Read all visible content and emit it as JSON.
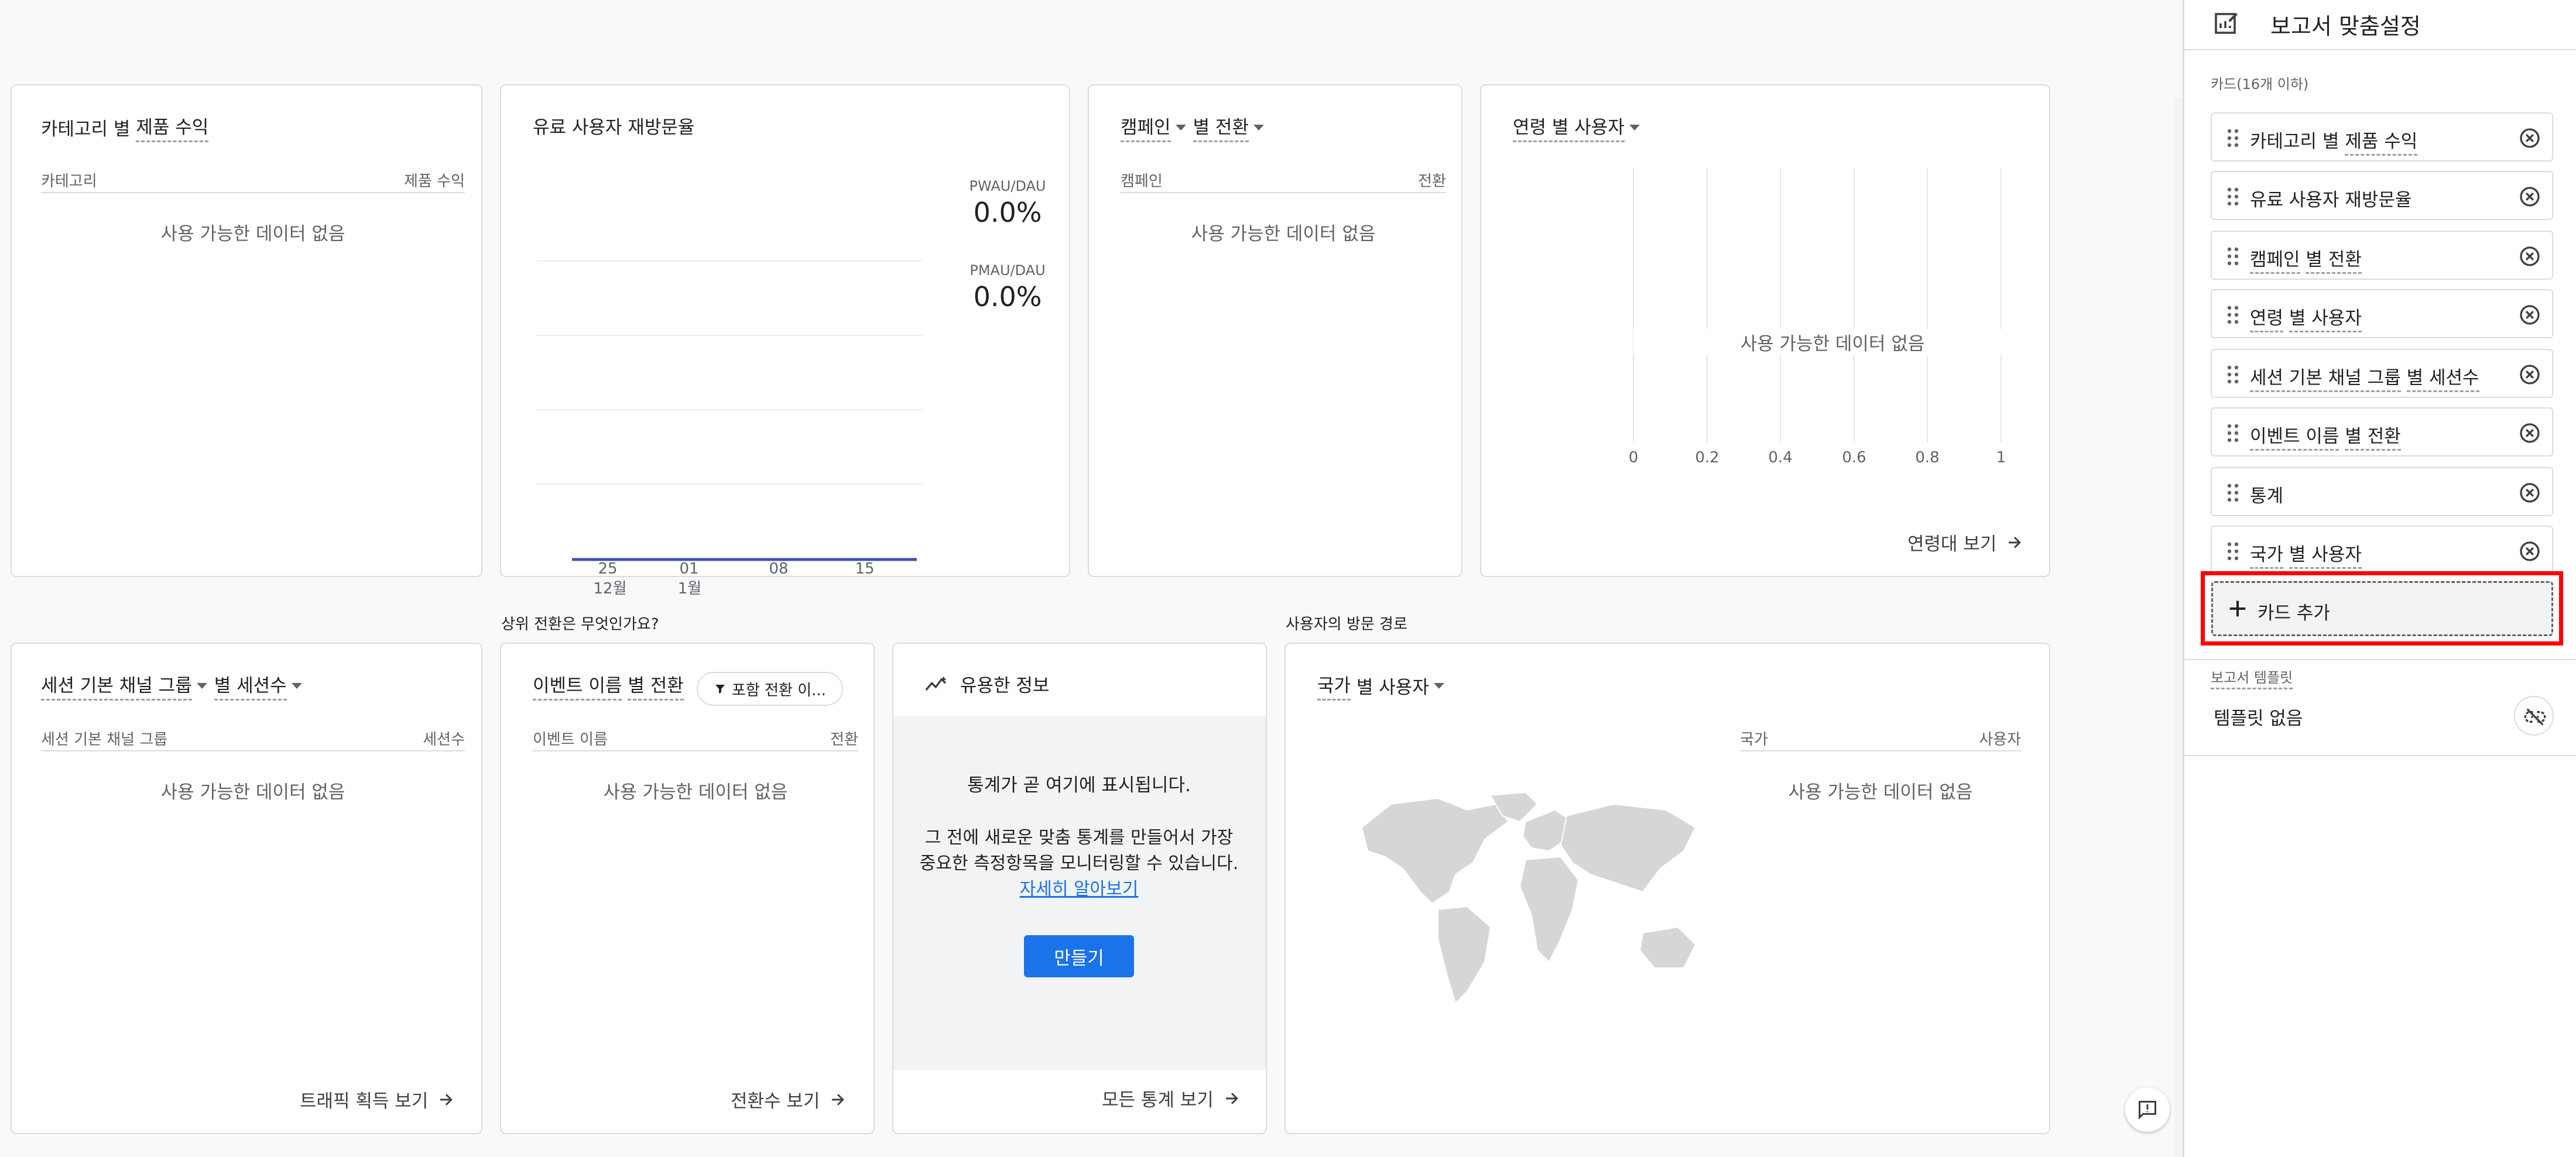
{
  "cards": {
    "category_revenue": {
      "title_prefix": "카테고리 별",
      "title_metric": "제품 수익",
      "col_left": "카테고리",
      "col_right": "제품 수익",
      "nodata": "사용 가능한 데이터 없음"
    },
    "retention": {
      "title": "유료 사용자 재방문율",
      "pwau_label": "PWAU/DAU",
      "pwau_value": "0.0%",
      "pmau_label": "PMAU/DAU",
      "pmau_value": "0.0%",
      "x_ticks": [
        "25",
        "01",
        "08",
        "15"
      ],
      "x_sub": [
        "12월",
        "1월"
      ],
      "line_color": "#3f51b5"
    },
    "campaign": {
      "title_dim": "캠페인",
      "title_metric": "별 전환",
      "col_left": "캠페인",
      "col_right": "전환",
      "nodata": "사용 가능한 데이터 없음"
    },
    "age": {
      "title": "연령 별 사용자",
      "nodata": "사용 가능한 데이터 없음",
      "x_ticks": [
        "0",
        "0.2",
        "0.4",
        "0.6",
        "0.8",
        "1"
      ],
      "footer": "연령대 보기"
    },
    "session_channel": {
      "title_dim": "세션 기본 채널 그룹",
      "title_metric": "별 세션수",
      "col_left": "세션 기본 채널 그룹",
      "col_right": "세션수",
      "nodata": "사용 가능한 데이터 없음",
      "footer": "트래픽 획득 보기"
    },
    "event_conversion": {
      "section_label": "상위 전환은 무엇인가요?",
      "title_dim": "이벤트 이름",
      "title_metric": "별 전환",
      "filter_chip": "포함 전환 이...",
      "col_left": "이벤트 이름",
      "col_right": "전환",
      "nodata": "사용 가능한 데이터 없음",
      "footer": "전환수 보기"
    },
    "insights": {
      "title": "유용한 정보",
      "line1": "통계가 곧 여기에 표시됩니다.",
      "body": "그 전에 새로운 맞춤 통계를 만들어서 가장 중요한 측정항목을 모니터링할 수 있습니다.",
      "learn_more": "자세히 알아보기",
      "create_button": "만들기",
      "footer": "모든 통계 보기"
    },
    "country": {
      "section_label": "사용자의 방문 경로",
      "title_dim": "국가",
      "title_metric": "별 사용자",
      "col_left": "국가",
      "col_right": "사용자",
      "nodata": "사용 가능한 데이터 없음"
    }
  },
  "sidebar": {
    "title": "보고서 맞춤설정",
    "cards_label": "카드(16개 이하)",
    "items": [
      {
        "pre": "카테고리 별",
        "metric": "제품 수익"
      },
      {
        "pre": "",
        "metric": "",
        "plain": "유료 사용자 재방문율"
      },
      {
        "pre": "캠페인",
        "metric": "별 전환",
        "dim_first": true
      },
      {
        "pre": "연령",
        "metric": "별 사용자",
        "dim_first": true
      },
      {
        "pre": "세션 기본 채널 그룹",
        "metric": "별 세션수",
        "dim_first": true
      },
      {
        "pre": "이벤트 이름",
        "metric": "별 전환",
        "dim_first": true
      },
      {
        "pre": "",
        "metric": "",
        "plain": "통계"
      },
      {
        "pre": "국가",
        "metric": "별 사용자",
        "dim_first": true
      }
    ],
    "add_card": "카드 추가",
    "template_label": "보고서 템플릿",
    "template_empty": "템플릿 없음",
    "highlight_color": "#ff0000"
  }
}
